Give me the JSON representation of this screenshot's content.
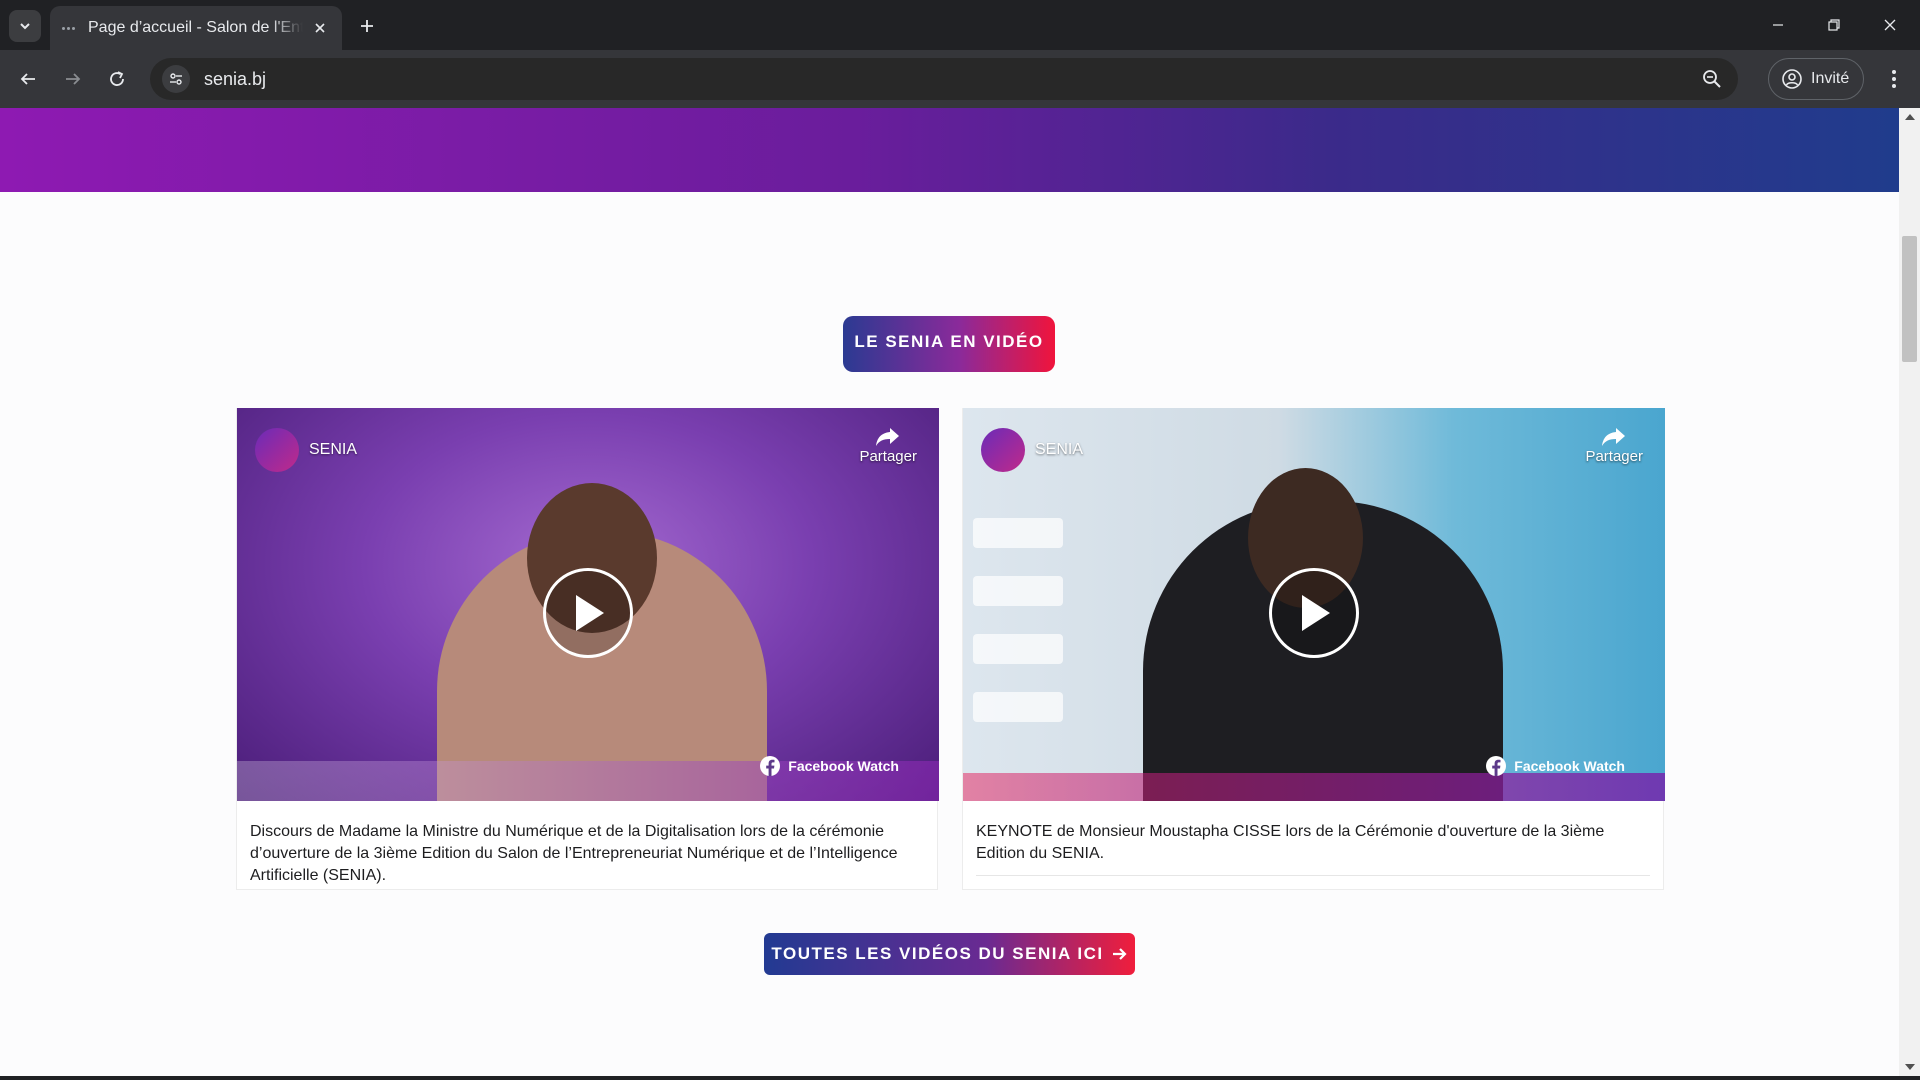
{
  "browser": {
    "tab_title": "Page d’accueil - Salon de l'Entrepreneuriat Numérique",
    "url": "senia.bj",
    "profile_label": "Invité"
  },
  "page": {
    "section_badge": "LE SENIA EN VIDÉO",
    "all_videos_button": "TOUTES LES VIDÉOS DU SENIA ICI",
    "videos": [
      {
        "page_name": "SENIA",
        "share_label": "Partager",
        "watch_label": "Facebook Watch",
        "caption": "Discours de Madame la Ministre du Numérique et de la Digitalisation lors de la cérémonie d’ouverture de la 3ième Edition du Salon de l’Entrepreneuriat Numérique et de l’Intelligence Artificielle (SENIA)."
      },
      {
        "page_name": "SENIA",
        "share_label": "Partager",
        "watch_label": "Facebook Watch",
        "caption": "KEYNOTE de Monsieur Moustapha CISSE lors de la Cérémonie d'ouverture de la 3ième Edition du SENIA."
      }
    ]
  },
  "icons": {
    "tab_search": "chevron-down-icon",
    "close": "close-icon",
    "new_tab": "plus-icon",
    "back": "arrow-left-icon",
    "forward": "arrow-right-icon",
    "reload": "reload-icon",
    "site_info": "tune-icon",
    "zoom": "zoom-icon",
    "profile": "user-icon",
    "menu": "kebab-icon",
    "share": "share-icon",
    "play": "play-icon",
    "facebook": "facebook-icon",
    "arrow_right": "arrow-right-icon"
  },
  "colors": {
    "brand_blue": "#223a92",
    "brand_purple": "#8e1ab2",
    "brand_red": "#f01e3c"
  }
}
